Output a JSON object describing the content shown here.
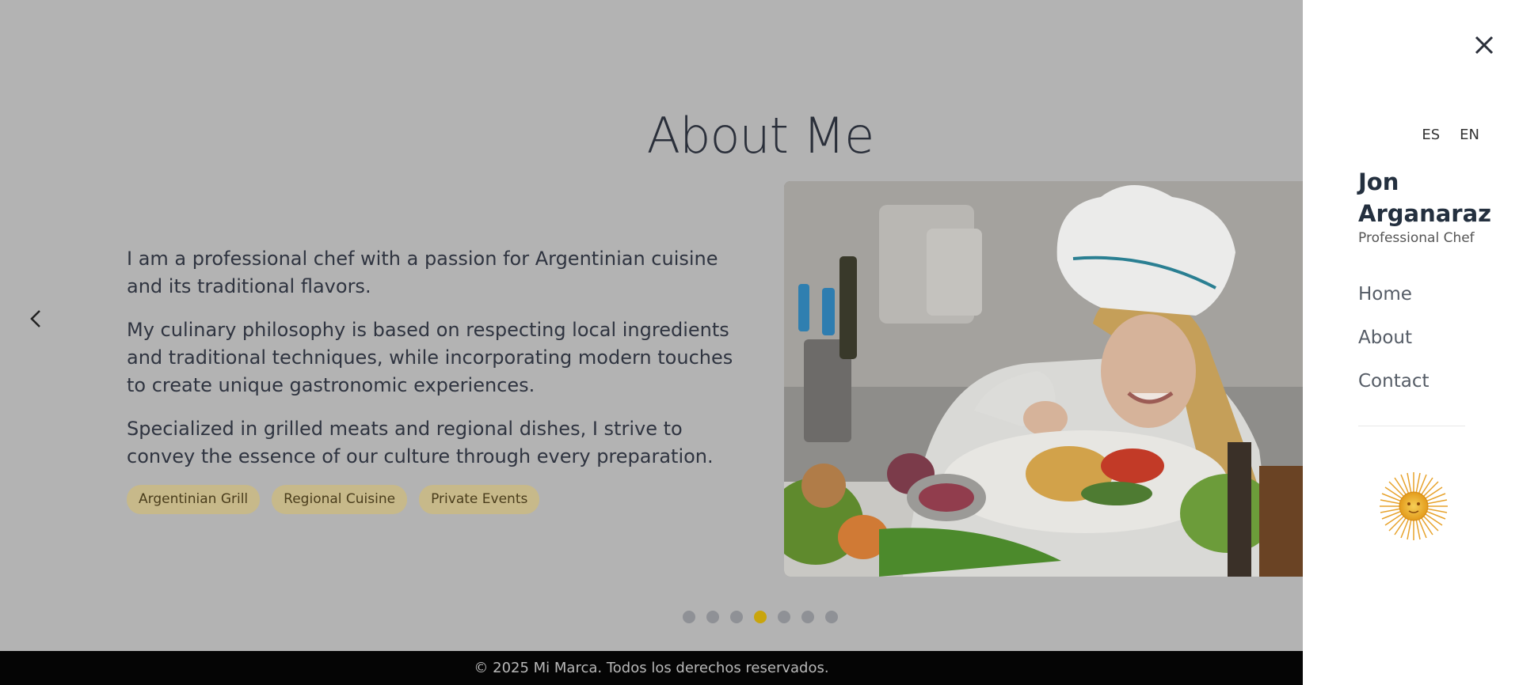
{
  "section": {
    "title": "About Me",
    "paragraphs": [
      "I am a professional chef with a passion for Argentinian cuisine and its traditional flavors.",
      "My culinary philosophy is based on respecting local ingredients and traditional techniques, while incorporating modern touches to create unique gastronomic experiences.",
      "Specialized in grilled meats and regional dishes, I strive to convey the essence of our culture through every preparation."
    ],
    "tags": [
      "Argentinian Grill",
      "Regional Cuisine",
      "Private Events"
    ]
  },
  "carousel": {
    "prev_icon": "chevron-left-icon",
    "total_slides": 7,
    "active_slide": 4
  },
  "footer": {
    "text": "© 2025 Mi Marca. Todos los derechos reservados."
  },
  "sidebar": {
    "close_icon": "close-icon",
    "languages": [
      "ES",
      "EN"
    ],
    "owner_name": "Jon Arganaraz",
    "owner_role": "Professional Chef",
    "nav": [
      "Home",
      "About",
      "Contact"
    ],
    "emblem_icon": "sun-of-may-icon"
  },
  "colors": {
    "overlay_bg": "#b3b3b3",
    "tag_bg": "#c7b98a",
    "active_dot": "#c9a50c",
    "footer_bg": "#050505"
  }
}
